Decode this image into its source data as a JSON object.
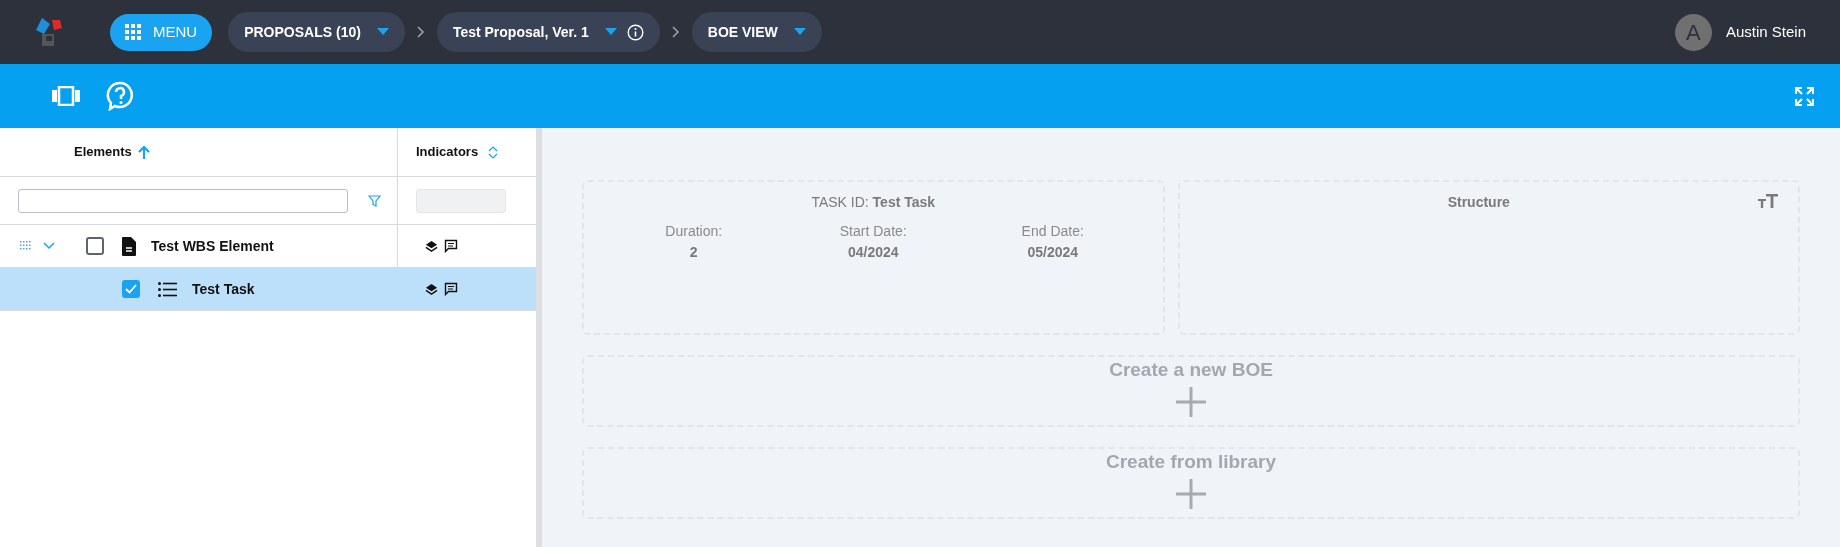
{
  "top_bar": {
    "menu_button": "MENU",
    "breadcrumbs": [
      {
        "label": "PROPOSALS (10)",
        "info": false
      },
      {
        "label": "Test Proposal, Ver. 1",
        "info": true
      },
      {
        "label": "BOE VIEW",
        "info": false
      }
    ],
    "user": {
      "initial": "A",
      "name": "Austin Stein"
    }
  },
  "table": {
    "columns": [
      {
        "label": "Elements",
        "sorted": true
      },
      {
        "label": "Indicators",
        "sorted": false
      }
    ],
    "rows": [
      {
        "label": "Test WBS Element",
        "kind": "element",
        "checked": false,
        "selected": false,
        "expanded": true,
        "children": [
          {
            "label": "Test Task",
            "kind": "task",
            "checked": true,
            "selected": true
          }
        ]
      }
    ]
  },
  "task_card": {
    "title_label": "TASK ID:",
    "title_value": "Test Task",
    "fields": [
      {
        "label": "Duration:",
        "value": "2"
      },
      {
        "label": "Start Date:",
        "value": "04/2024"
      },
      {
        "label": "End Date:",
        "value": "05/2024"
      }
    ]
  },
  "structure_card": {
    "title": "Structure"
  },
  "actions": [
    "Create a new BOE",
    "Create from library"
  ]
}
